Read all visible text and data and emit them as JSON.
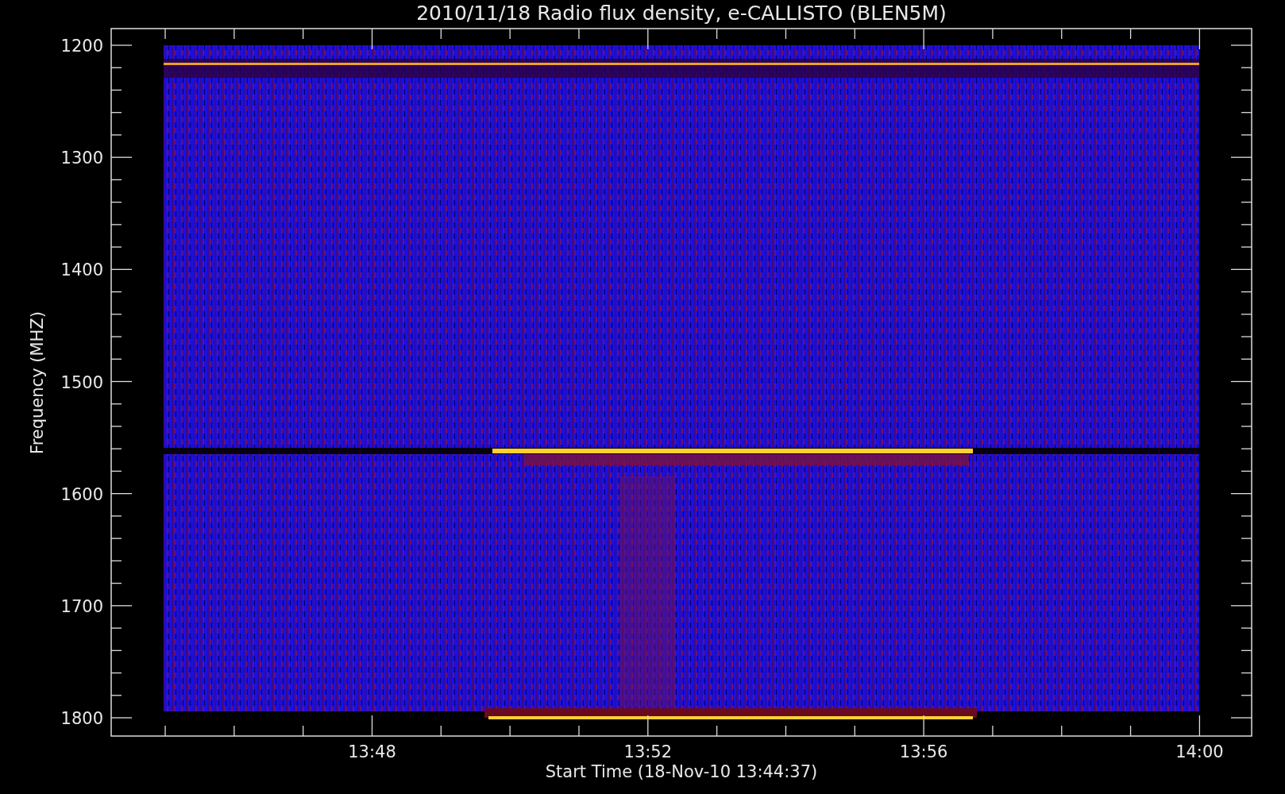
{
  "title": "2010/11/18  Radio flux density, e-CALLISTO (BLEN5M)",
  "y_axis": {
    "label": "Frequency (MHZ)",
    "ticks": [
      "1200",
      "1300",
      "1400",
      "1500",
      "1600",
      "1700",
      "1800"
    ]
  },
  "x_axis": {
    "label": "Start Time (18-Nov-10 13:44:37)",
    "ticks": [
      "13:48",
      "13:52",
      "13:56",
      "14:00"
    ]
  }
}
